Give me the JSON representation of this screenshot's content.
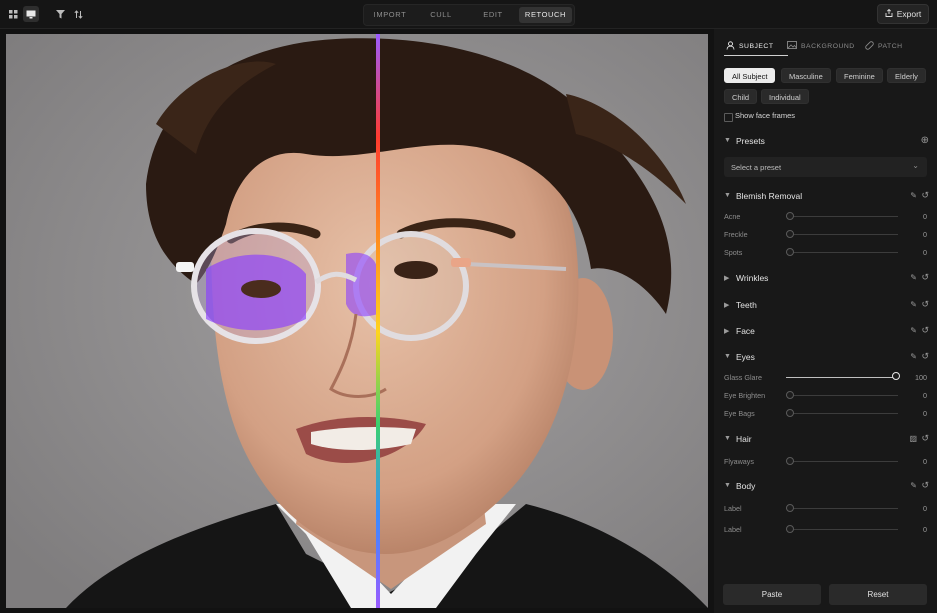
{
  "topbar": {
    "icons": [
      "grid-icon",
      "monitor-icon",
      "filter-icon",
      "sort-icon"
    ],
    "modes": [
      {
        "label": "IMPORT",
        "active": false
      },
      {
        "label": "CULL",
        "active": false
      },
      {
        "label": "EDIT",
        "active": false
      },
      {
        "label": "RETOUCH",
        "active": true
      }
    ],
    "export_label": "Export"
  },
  "panel": {
    "tabs": [
      {
        "label": "SUBJECT",
        "icon": "person-icon",
        "active": true
      },
      {
        "label": "BACKGROUND",
        "icon": "image-icon",
        "active": false
      },
      {
        "label": "PATCH",
        "icon": "bandage-icon",
        "active": false
      }
    ],
    "chips": [
      {
        "label": "All Subject",
        "active": true
      },
      {
        "label": "Masculine",
        "active": false
      },
      {
        "label": "Feminine",
        "active": false
      },
      {
        "label": "Elderly",
        "active": false
      },
      {
        "label": "Child",
        "active": false
      },
      {
        "label": "Individual",
        "active": false
      }
    ],
    "show_face_frames": "Show face frames",
    "presets": {
      "title": "Presets",
      "placeholder": "Select a preset"
    },
    "sections": {
      "blemish": {
        "title": "Blemish Removal",
        "sliders": [
          {
            "label": "Acne",
            "value": 0
          },
          {
            "label": "Freckle",
            "value": 0
          },
          {
            "label": "Spots",
            "value": 0
          }
        ]
      },
      "wrinkles": {
        "title": "Wrinkles"
      },
      "teeth": {
        "title": "Teeth"
      },
      "face": {
        "title": "Face"
      },
      "eyes": {
        "title": "Eyes",
        "sliders": [
          {
            "label": "Glass Glare",
            "value": 100
          },
          {
            "label": "Eye Brighten",
            "value": 0
          },
          {
            "label": "Eye Bags",
            "value": 0
          }
        ]
      },
      "hair": {
        "title": "Hair",
        "sliders": [
          {
            "label": "Flyaways",
            "value": 0
          }
        ]
      },
      "body": {
        "title": "Body",
        "sliders": [
          {
            "label": "Label",
            "value": 0
          },
          {
            "label": "Label",
            "value": 0
          }
        ]
      }
    },
    "paste_label": "Paste",
    "reset_label": "Reset"
  },
  "colors": {
    "accent": "#ececec",
    "panel_bg": "#181818",
    "split_line": [
      "#9b5cff",
      "#ff3b2f",
      "#ff8a1f",
      "#ffd41f",
      "#3bd16f",
      "#3b8bff"
    ]
  }
}
